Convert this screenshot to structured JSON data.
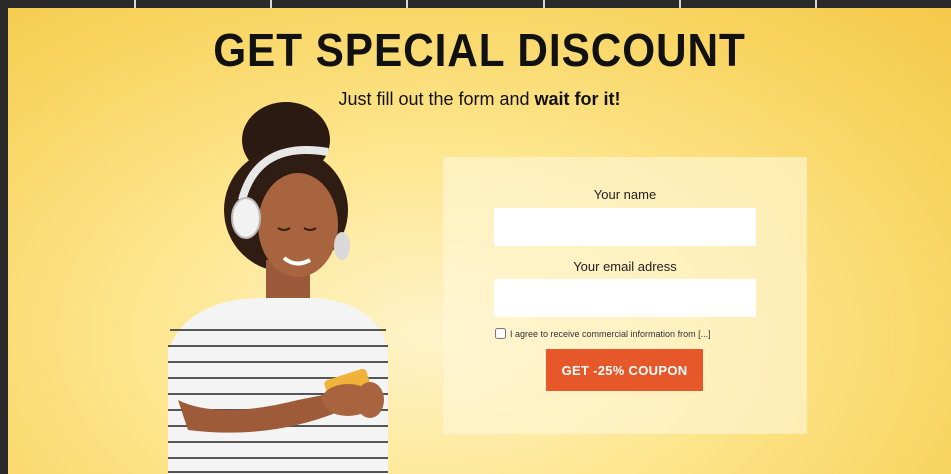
{
  "hero": {
    "headline": "GET SPECIAL DISCOUNT",
    "subline_prefix": "Just fill out the form and ",
    "subline_bold": "wait for it!"
  },
  "form": {
    "name_label": "Your name",
    "name_value": "",
    "email_label": "Your email adress",
    "email_value": "",
    "agree_text": "I agree to receive commercial information from [...]",
    "agree_checked": false,
    "submit_label": "GET -25% COUPON"
  },
  "colors": {
    "background_yellow": "#f8d25b",
    "button_orange": "#e6582a"
  }
}
